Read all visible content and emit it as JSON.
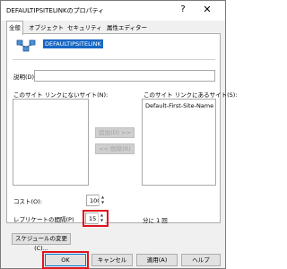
{
  "window": {
    "title": "DEFAULTIPSITELINKのプロパティ",
    "help_glyph": "?",
    "close_glyph": "✕"
  },
  "tabs": [
    {
      "label": "全般",
      "active": true
    },
    {
      "label": "オブジェクト",
      "active": false
    },
    {
      "label": "セキュリティ",
      "active": false
    },
    {
      "label": "属性エディター",
      "active": false
    }
  ],
  "general": {
    "site_link_name": "DEFAULTIPSITELINK",
    "description_label": "説明(D):",
    "description_value": "",
    "not_in_link_label": "このサイト リンクにないサイト(N):",
    "not_in_link_items": [],
    "in_link_label": "このサイト リンクにあるサイト(S):",
    "in_link_items": [
      "Default-First-Site-Name"
    ],
    "add_button": "追加(D) >>",
    "remove_button": "<< 削除(R)",
    "cost_label": "コスト(O):",
    "cost_value": "100",
    "replication_label": "レプリケートの間隔(P)",
    "replication_value": "15",
    "replication_unit": "分に 1 回",
    "schedule_button": "スケジュールの変更(C)..."
  },
  "footer": {
    "ok": "OK",
    "cancel": "キャンセル",
    "apply": "適用(A)",
    "help": "ヘルプ"
  },
  "colors": {
    "selection": "#1667c4",
    "highlight": "#e0141e"
  }
}
